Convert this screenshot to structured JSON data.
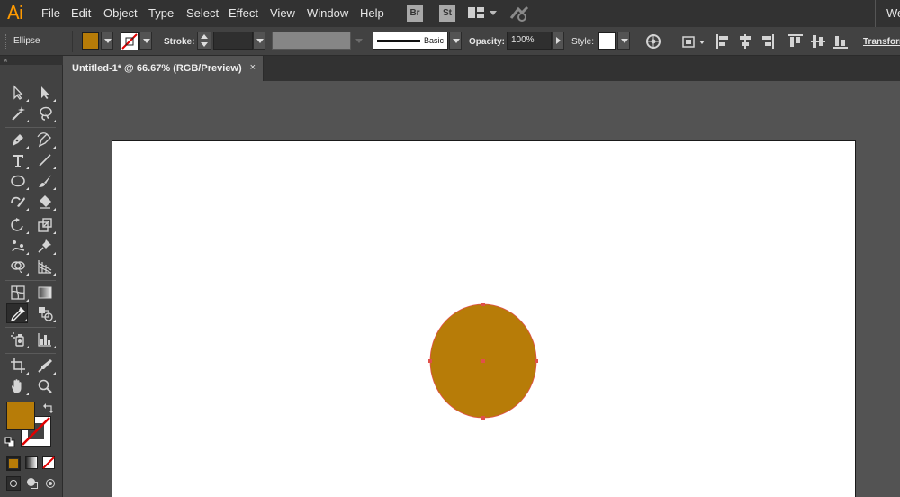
{
  "app": {
    "logo": "Ai"
  },
  "menubar": {
    "items": [
      "File",
      "Edit",
      "Object",
      "Type",
      "Select",
      "Effect",
      "View",
      "Window",
      "Help"
    ],
    "bridge_label": "Br",
    "stock_label": "St",
    "workspace_label": "We"
  },
  "controlbar": {
    "selection_label": "Ellipse",
    "fill_color": "#b77c08",
    "stroke_label": "Stroke:",
    "stroke_weight": "",
    "brush_label": "Basic",
    "opacity_label": "Opacity:",
    "opacity_value": "100%",
    "style_label": "Style:",
    "transform_label": "Transform"
  },
  "toolbar": {
    "collapse_label": "«",
    "fill_color": "#b77c08",
    "active_tool": "eyedropper"
  },
  "document": {
    "tab_label": "Untitled-1* @ 66.67% (RGB/Preview)",
    "tab_close": "×"
  },
  "artwork": {
    "shape": "ellipse",
    "fill_color": "#b77c08",
    "selection_color": "#e0504a"
  },
  "colors": {
    "menubar_bg": "#323232",
    "panel_bg": "#424242",
    "canvas_bg": "#535353",
    "artboard_bg": "#ffffff",
    "app_logo": "#ff9a00"
  }
}
